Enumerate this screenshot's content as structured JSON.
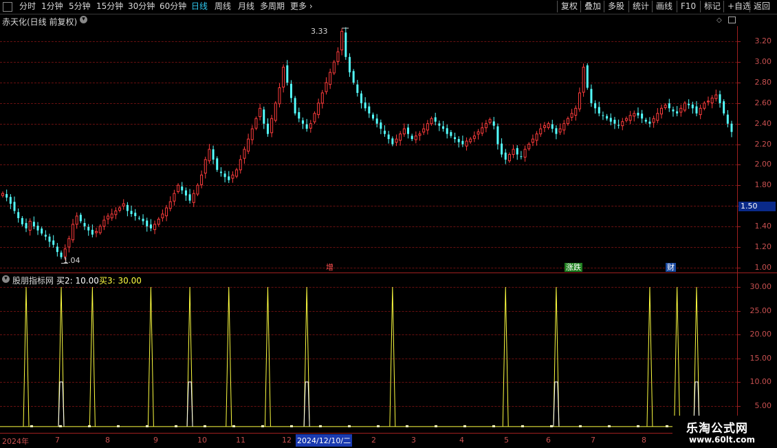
{
  "toolbar": {
    "periods": [
      "分时",
      "1分钟",
      "5分钟",
      "15分钟",
      "30分钟",
      "60分钟",
      "日线",
      "周线",
      "月线",
      "多周期",
      "更多"
    ],
    "active": "日线",
    "right_buttons": [
      "复权",
      "叠加",
      "多股",
      "统计",
      "画线",
      "F10",
      "标记",
      "+自选",
      "返回"
    ]
  },
  "chart_title": "赤天化(日线 前复权)",
  "price_axis": {
    "labels": [
      "3.20",
      "3.00",
      "2.80",
      "2.60",
      "2.40",
      "2.20",
      "2.00",
      "1.80",
      "1.60",
      "1.40",
      "1.20",
      "1.00"
    ],
    "current": "1.50"
  },
  "high_label": "3.33",
  "low_label": "1.04",
  "markers": [
    {
      "text": "增",
      "color": "#c03030"
    },
    {
      "text": "涨跌",
      "color": "#30a030"
    },
    {
      "text": "财",
      "color": "#2060c0"
    }
  ],
  "indicator": {
    "name": "股朋指标网",
    "buy2_label": "买2: 10.00",
    "buy3_label": "买3: 30.00",
    "axis_labels": [
      "30.00",
      "25.00",
      "20.00",
      "15.00",
      "10.00",
      "5.00"
    ]
  },
  "date_axis": {
    "labels": [
      "2024年",
      "7",
      "8",
      "9",
      "10",
      "11",
      "12",
      "2024/12/10/二",
      "2",
      "3",
      "4",
      "5",
      "6",
      "7",
      "8"
    ]
  },
  "watermark": {
    "line1": "乐淘公式网",
    "line2": "www.60lt.com"
  },
  "colors": {
    "up": "#ff3c3c",
    "down": "#54ffff",
    "grid": "#6a1010",
    "buy3": "#ffff40",
    "buy2": "#ffffff"
  },
  "chart_data": {
    "type": "candlestick",
    "title": "赤天化(日线 前复权)",
    "ylim": [
      0.95,
      3.35
    ],
    "close_series": [
      1.72,
      1.68,
      1.62,
      1.55,
      1.48,
      1.42,
      1.38,
      1.45,
      1.4,
      1.36,
      1.33,
      1.3,
      1.25,
      1.22,
      1.15,
      1.1,
      1.18,
      1.28,
      1.42,
      1.5,
      1.45,
      1.4,
      1.36,
      1.32,
      1.35,
      1.4,
      1.46,
      1.5,
      1.52,
      1.55,
      1.58,
      1.62,
      1.55,
      1.52,
      1.5,
      1.48,
      1.45,
      1.4,
      1.38,
      1.42,
      1.47,
      1.52,
      1.58,
      1.64,
      1.72,
      1.8,
      1.75,
      1.7,
      1.65,
      1.72,
      1.8,
      1.9,
      2.05,
      2.15,
      2.05,
      1.95,
      1.92,
      1.88,
      1.85,
      1.9,
      1.95,
      2.05,
      2.15,
      2.25,
      2.35,
      2.45,
      2.55,
      2.4,
      2.3,
      2.45,
      2.6,
      2.75,
      2.95,
      2.8,
      2.65,
      2.5,
      2.45,
      2.4,
      2.35,
      2.4,
      2.5,
      2.6,
      2.7,
      2.8,
      2.9,
      3.0,
      3.1,
      3.3,
      3.05,
      2.9,
      2.8,
      2.7,
      2.6,
      2.55,
      2.5,
      2.45,
      2.4,
      2.35,
      2.3,
      2.25,
      2.2,
      2.25,
      2.3,
      2.35,
      2.3,
      2.25,
      2.28,
      2.3,
      2.35,
      2.4,
      2.45,
      2.42,
      2.38,
      2.35,
      2.3,
      2.28,
      2.25,
      2.22,
      2.2,
      2.23,
      2.25,
      2.28,
      2.32,
      2.36,
      2.4,
      2.44,
      2.38,
      2.2,
      2.1,
      2.05,
      2.1,
      2.15,
      2.1,
      2.08,
      2.15,
      2.2,
      2.25,
      2.3,
      2.35,
      2.38,
      2.4,
      2.35,
      2.3,
      2.35,
      2.4,
      2.45,
      2.5,
      2.55,
      2.7,
      2.95,
      2.75,
      2.6,
      2.55,
      2.5,
      2.48,
      2.45,
      2.42,
      2.4,
      2.38,
      2.42,
      2.45,
      2.48,
      2.5,
      2.48,
      2.45,
      2.42,
      2.4,
      2.45,
      2.5,
      2.55,
      2.58,
      2.55,
      2.52,
      2.5,
      2.55,
      2.6,
      2.58,
      2.55,
      2.5,
      2.55,
      2.6,
      2.62,
      2.65,
      2.68,
      2.6,
      2.5,
      2.4,
      2.32
    ],
    "high": 3.33,
    "low": 1.04,
    "indicator_series": [
      {
        "name": "买2",
        "value": 10.0
      },
      {
        "name": "买3",
        "value": 30.0
      }
    ]
  }
}
